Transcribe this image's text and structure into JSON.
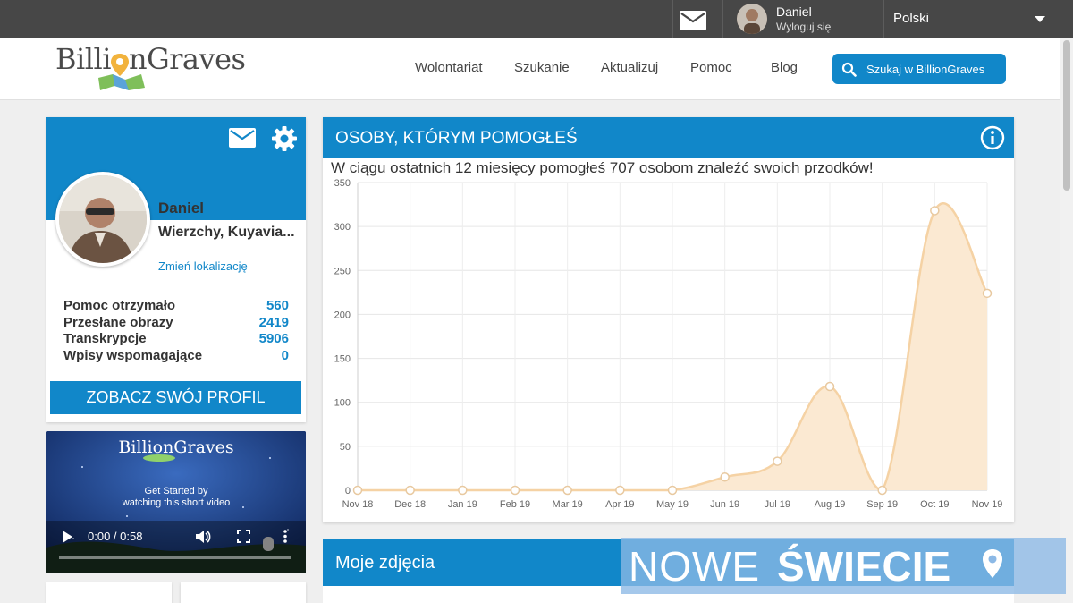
{
  "topbar": {
    "user_name": "Daniel",
    "logout": "Wyloguj się",
    "language": "Polski"
  },
  "header": {
    "logo_left": "Billi",
    "logo_right": "nGraves",
    "nav": [
      "Wolontariat",
      "Szukanie",
      "Aktualizuj",
      "Pomoc",
      "Blog"
    ],
    "search_label": "Szukaj w BillionGraves"
  },
  "profile": {
    "name": "Daniel",
    "location": "Wierzchy, Kuyavia...",
    "change_location": "Zmień lokalizację",
    "stats": [
      {
        "label": "Pomoc otrzymało",
        "value": "560"
      },
      {
        "label": "Przesłane obrazy",
        "value": "2419"
      },
      {
        "label": "Transkrypcje",
        "value": "5906"
      },
      {
        "label": "Wpisy wspomagające",
        "value": "0"
      }
    ],
    "view_profile": "ZOBACZ SWÓJ PROFIL"
  },
  "video": {
    "logo": "BillionGraves",
    "caption_line1": "Get Started by",
    "caption_line2": "watching this short video",
    "time": "0:00 / 0:58"
  },
  "helped": {
    "title": "OSOBY, KTÓRYM POMOGŁEŚ",
    "subtitle": "W ciągu ostatnich 12 miesięcy pomogłeś 707 osobom znaleźć swoich przodków!"
  },
  "photos": {
    "title": "Moje zdjęcia"
  },
  "watermark": {
    "part1": "NOWE",
    "part2": "ŚWIECIE"
  },
  "colors": {
    "brand": "#1187c9",
    "topbar": "#474747",
    "area_fill": "#fbe9d2",
    "area_line": "#f5d2a4"
  },
  "chart_data": {
    "type": "area",
    "categories": [
      "Nov 18",
      "Dec 18",
      "Jan 19",
      "Feb 19",
      "Mar 19",
      "Apr 19",
      "May 19",
      "Jun 19",
      "Jul 19",
      "Aug 19",
      "Sep 19",
      "Oct 19",
      "Nov 19"
    ],
    "values": [
      0,
      0,
      0,
      0,
      0,
      0,
      0,
      15,
      33,
      118,
      0,
      318,
      224
    ],
    "ylim": [
      0,
      350
    ],
    "yticks": [
      0,
      50,
      100,
      150,
      200,
      250,
      300,
      350
    ],
    "grid": true,
    "legend": "none"
  }
}
